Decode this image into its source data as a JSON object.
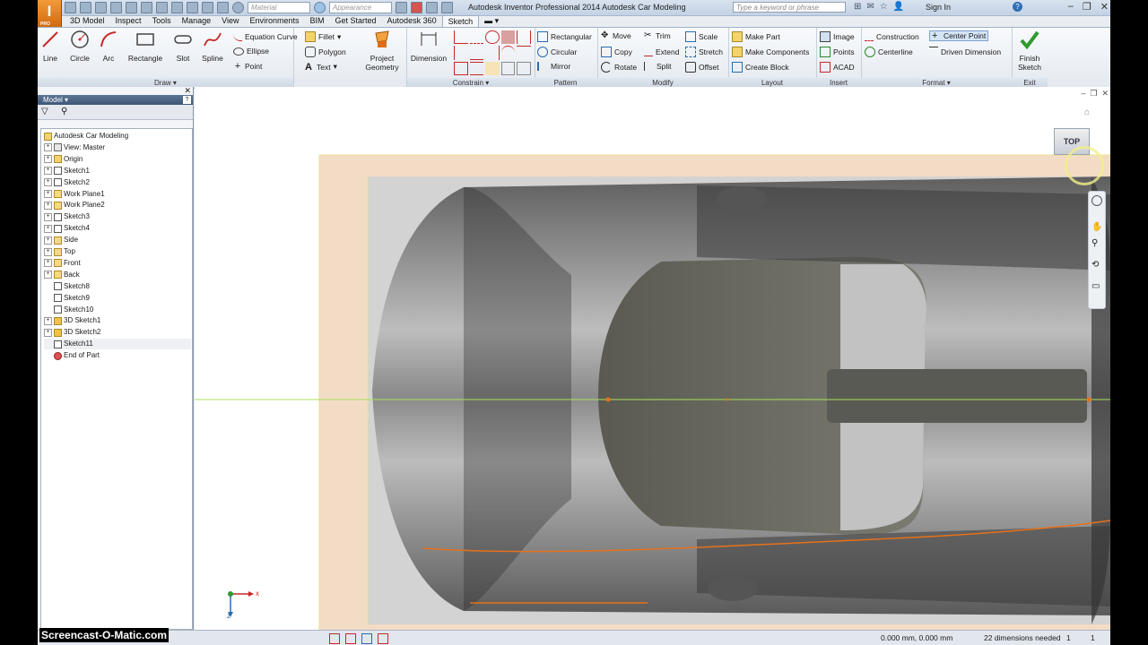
{
  "app": {
    "window_title": "Autodesk Inventor Professional 2014    Autodesk Car Modeling",
    "logo_letter": "I",
    "logo_sub": "PRO",
    "material_placeholder": "Material",
    "appearance_placeholder": "Appearance",
    "search_placeholder": "Type a keyword or phrase",
    "sign_in": "Sign In",
    "help": "?"
  },
  "tabs": [
    "3D Model",
    "Inspect",
    "Tools",
    "Manage",
    "View",
    "Environments",
    "BIM",
    "Get Started",
    "Autodesk 360",
    "Sketch"
  ],
  "ribbon": {
    "draw": {
      "title": "Draw",
      "line": "Line",
      "circle": "Circle",
      "arc": "Arc",
      "rectangle": "Rectangle",
      "slot": "Slot",
      "spline": "Spline",
      "equation_curve": "Equation Curve",
      "ellipse": "Ellipse",
      "point": "Point",
      "fillet": "Fillet",
      "polygon": "Polygon",
      "text": "Text",
      "project_geometry_1": "Project",
      "project_geometry_2": "Geometry"
    },
    "constrain": {
      "title": "Constrain",
      "dimension": "Dimension"
    },
    "pattern": {
      "title": "Pattern",
      "rectangular": "Rectangular",
      "circular": "Circular",
      "mirror": "Mirror"
    },
    "modify": {
      "title": "Modify",
      "move": "Move",
      "copy": "Copy",
      "rotate": "Rotate",
      "trim": "Trim",
      "extend": "Extend",
      "split": "Split",
      "scale": "Scale",
      "stretch": "Stretch",
      "offset": "Offset"
    },
    "layout": {
      "title": "Layout",
      "make_part": "Make Part",
      "make_components": "Make Components",
      "create_block": "Create Block"
    },
    "insert": {
      "title": "Insert",
      "image": "Image",
      "points": "Points",
      "acad": "ACAD"
    },
    "format": {
      "title": "Format",
      "construction": "Construction",
      "centerline": "Centerline",
      "center_point": "Center Point",
      "driven_dimension": "Driven Dimension"
    },
    "exit": {
      "title": "Exit",
      "finish_1": "Finish",
      "finish_2": "Sketch"
    }
  },
  "browser": {
    "title": "Model",
    "tree": [
      {
        "label": "Autodesk Car Modeling",
        "icon": "part-icon",
        "level": 0,
        "expand": false
      },
      {
        "label": "View: Master",
        "icon": "view-icon",
        "level": 1,
        "expand": true
      },
      {
        "label": "Origin",
        "icon": "folder-icon",
        "level": 1,
        "expand": true
      },
      {
        "label": "Sketch1",
        "icon": "sketch-icon",
        "level": 1,
        "expand": true
      },
      {
        "label": "Sketch2",
        "icon": "sketch-icon",
        "level": 1,
        "expand": true
      },
      {
        "label": "Work Plane1",
        "icon": "workplane-icon",
        "level": 1,
        "expand": true
      },
      {
        "label": "Work Plane2",
        "icon": "workplane-icon",
        "level": 1,
        "expand": true
      },
      {
        "label": "Sketch3",
        "icon": "sketch-icon",
        "level": 1,
        "expand": true
      },
      {
        "label": "Sketch4",
        "icon": "sketch-icon",
        "level": 1,
        "expand": true
      },
      {
        "label": "Side",
        "icon": "workplane-icon",
        "level": 1,
        "expand": true
      },
      {
        "label": "Top",
        "icon": "workplane-icon",
        "level": 1,
        "expand": true
      },
      {
        "label": "Front",
        "icon": "workplane-icon",
        "level": 1,
        "expand": true
      },
      {
        "label": "Back",
        "icon": "workplane-icon",
        "level": 1,
        "expand": true
      },
      {
        "label": "Sketch8",
        "icon": "sketch-icon",
        "level": 1,
        "expand": false
      },
      {
        "label": "Sketch9",
        "icon": "sketch-icon",
        "level": 1,
        "expand": false
      },
      {
        "label": "Sketch10",
        "icon": "sketch-icon",
        "level": 1,
        "expand": false
      },
      {
        "label": "3D Sketch1",
        "icon": "sketch3d-icon",
        "level": 1,
        "expand": true
      },
      {
        "label": "3D Sketch2",
        "icon": "sketch3d-icon",
        "level": 1,
        "expand": true
      },
      {
        "label": "Sketch11",
        "icon": "sketch-icon",
        "level": 1,
        "expand": false
      },
      {
        "label": "End of Part",
        "icon": "end-of-part-icon",
        "level": 1,
        "expand": false
      }
    ]
  },
  "viewcube": {
    "face": "TOP"
  },
  "triad": {
    "x": "x",
    "z": "z"
  },
  "status": {
    "coordinates": "0.000 mm, 0.000 mm",
    "dimensions_needed": "22 dimensions needed",
    "count_a": "1",
    "count_b": "1"
  },
  "watermark": "Screencast-O-Matic.com",
  "colors": {
    "accent_orange": "#e8711a",
    "axis_green": "#a8e05a",
    "ribbon_blue": "#3e5677",
    "image_frame": "#f2dcc6"
  }
}
